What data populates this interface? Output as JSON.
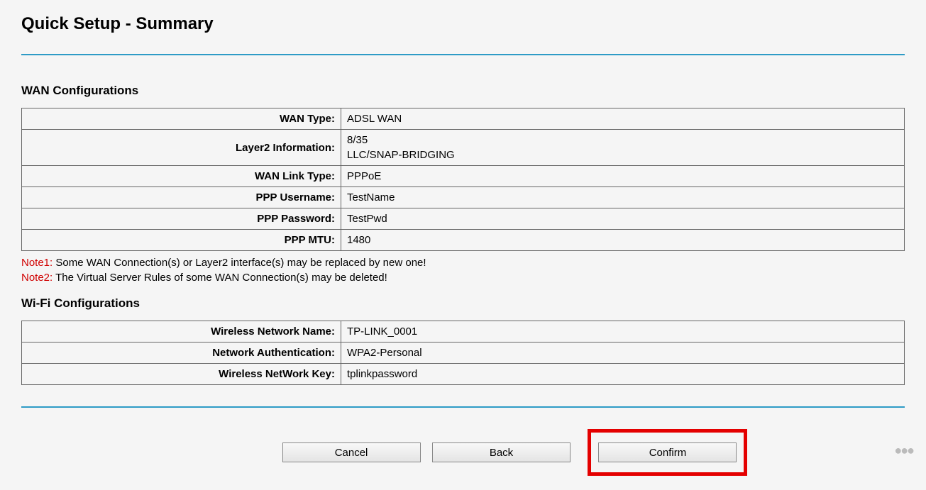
{
  "title": "Quick Setup - Summary",
  "sections": {
    "wan": {
      "heading": "WAN Configurations",
      "rows": [
        {
          "label": "WAN Type:",
          "value": "ADSL WAN"
        },
        {
          "label": "Layer2 Information:",
          "value": "8/35\nLLC/SNAP-BRIDGING"
        },
        {
          "label": "WAN Link Type:",
          "value": "PPPoE"
        },
        {
          "label": "PPP Username:",
          "value": "TestName"
        },
        {
          "label": "PPP Password:",
          "value": "TestPwd"
        },
        {
          "label": "PPP MTU:",
          "value": "1480"
        }
      ]
    },
    "notes": [
      {
        "prefix": "Note1:",
        "text": " Some WAN Connection(s) or Layer2 interface(s) may be replaced by new one!"
      },
      {
        "prefix": "Note2:",
        "text": " The Virtual Server Rules of some WAN Connection(s) may be deleted!"
      }
    ],
    "wifi": {
      "heading": "Wi-Fi Configurations",
      "rows": [
        {
          "label": "Wireless Network Name:",
          "value": "TP-LINK_0001"
        },
        {
          "label": "Network Authentication:",
          "value": "WPA2-Personal"
        },
        {
          "label": "Wireless NetWork Key:",
          "value": "tplinkpassword"
        }
      ]
    }
  },
  "buttons": {
    "cancel": "Cancel",
    "back": "Back",
    "confirm": "Confirm"
  }
}
